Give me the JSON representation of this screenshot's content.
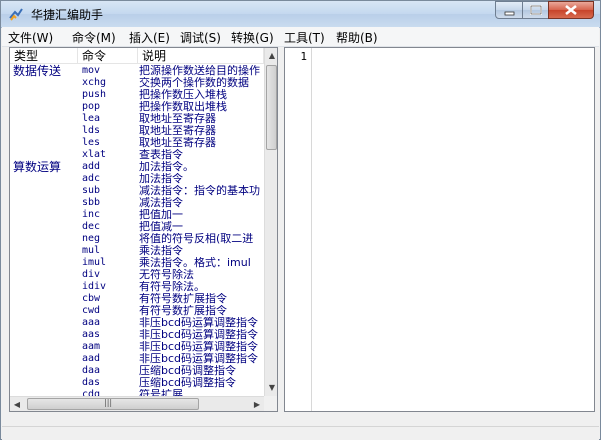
{
  "window": {
    "title": "华捷汇编助手"
  },
  "menu": [
    "文件(W)",
    "命令(M)",
    "插入(E)",
    "调试(S)",
    "转换(G)",
    "工具(T)",
    "帮助(B)"
  ],
  "list_headers": [
    "类型",
    "命令",
    "说明"
  ],
  "rows": [
    {
      "type": "数据传送",
      "cmd": "mov",
      "desc": "把源操作数送给目的操作"
    },
    {
      "type": "",
      "cmd": "xchg",
      "desc": "交换两个操作数的数据"
    },
    {
      "type": "",
      "cmd": "push",
      "desc": "把操作数压入堆栈"
    },
    {
      "type": "",
      "cmd": "pop",
      "desc": "把操作数取出堆栈"
    },
    {
      "type": "",
      "cmd": "lea",
      "desc": "取地址至寄存器"
    },
    {
      "type": "",
      "cmd": "lds",
      "desc": "取地址至寄存器"
    },
    {
      "type": "",
      "cmd": "les",
      "desc": "取地址至寄存器"
    },
    {
      "type": "",
      "cmd": "xlat",
      "desc": "查表指令"
    },
    {
      "type": "算数运算",
      "cmd": "add",
      "desc": "加法指令。"
    },
    {
      "type": "",
      "cmd": "adc",
      "desc": "加法指令"
    },
    {
      "type": "",
      "cmd": "sub",
      "desc": "减法指令：指令的基本功"
    },
    {
      "type": "",
      "cmd": "sbb",
      "desc": "减法指令"
    },
    {
      "type": "",
      "cmd": "inc",
      "desc": "把值加一"
    },
    {
      "type": "",
      "cmd": "dec",
      "desc": "把值减一"
    },
    {
      "type": "",
      "cmd": "neg",
      "desc": "将值的符号反相(取二进"
    },
    {
      "type": "",
      "cmd": "mul",
      "desc": "乘法指令"
    },
    {
      "type": "",
      "cmd": "imul",
      "desc": "乘法指令。格式：imul"
    },
    {
      "type": "",
      "cmd": "div",
      "desc": "无符号除法"
    },
    {
      "type": "",
      "cmd": "idiv",
      "desc": "有符号除法。"
    },
    {
      "type": "",
      "cmd": "cbw",
      "desc": "有符号数扩展指令"
    },
    {
      "type": "",
      "cmd": "cwd",
      "desc": "有符号数扩展指令"
    },
    {
      "type": "",
      "cmd": "aaa",
      "desc": "非压bcd码运算调整指令"
    },
    {
      "type": "",
      "cmd": "aas",
      "desc": "非压bcd码运算调整指令"
    },
    {
      "type": "",
      "cmd": "aam",
      "desc": "非压bcd码运算调整指令"
    },
    {
      "type": "",
      "cmd": "aad",
      "desc": "非压bcd码运算调整指令"
    },
    {
      "type": "",
      "cmd": "daa",
      "desc": "压缩bcd码调整指令"
    },
    {
      "type": "",
      "cmd": "das",
      "desc": "压缩bcd码调整指令"
    },
    {
      "type": "",
      "cmd": "cdq",
      "desc": "符号扩展"
    }
  ],
  "hscroll_label": "|||",
  "editor": {
    "line_number": "1"
  }
}
